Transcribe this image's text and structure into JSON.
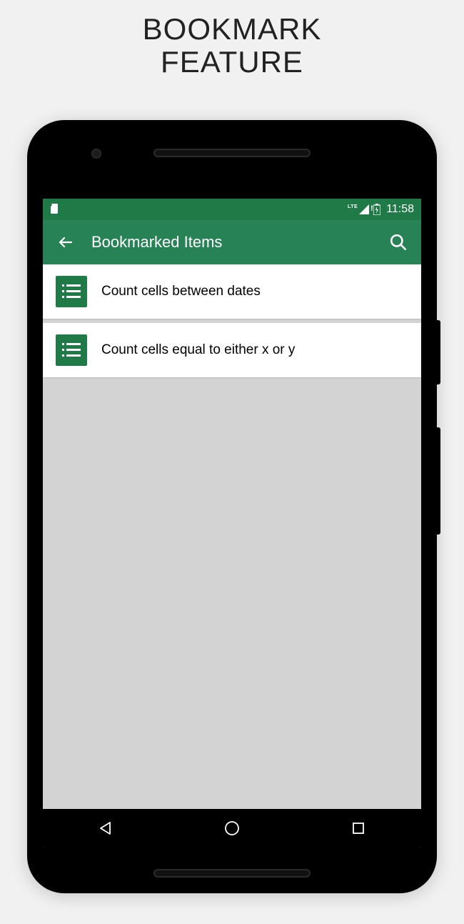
{
  "promo": {
    "line1": "BOOKMARK",
    "line2": "FEATURE"
  },
  "status": {
    "lte": "LTE",
    "time": "11:58"
  },
  "appbar": {
    "title": "Bookmarked Items"
  },
  "items": [
    {
      "label": "Count cells between dates"
    },
    {
      "label": "Count cells equal to either x or y"
    }
  ]
}
